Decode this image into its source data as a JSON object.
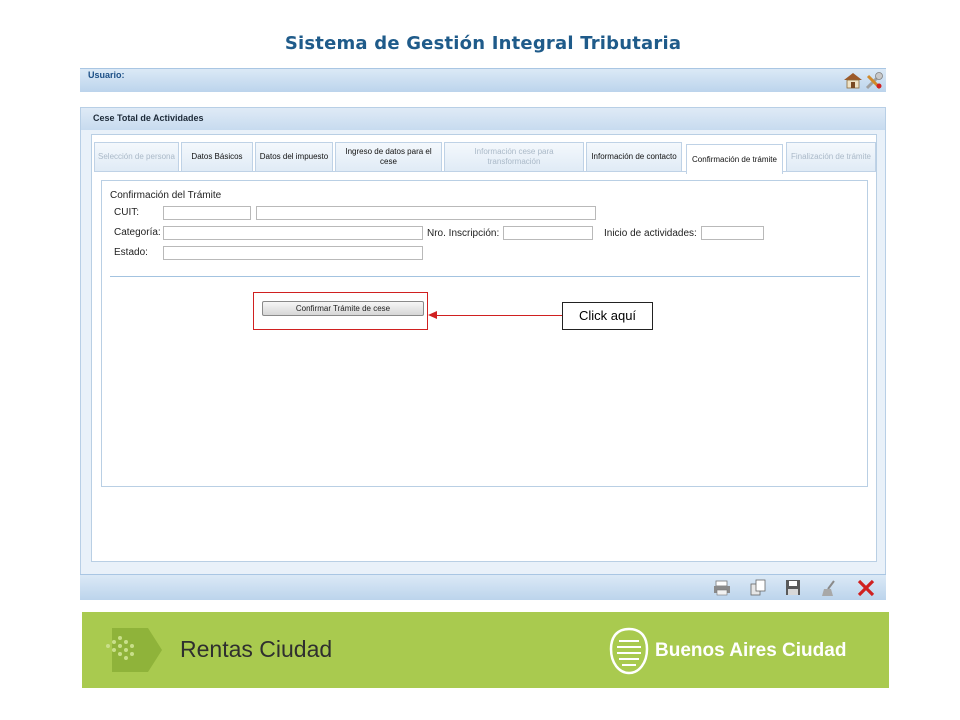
{
  "app_title": "Sistema de Gestión Integral Tributaria",
  "user_bar": {
    "label": "Usuario:"
  },
  "panel": {
    "title": "Cese Total de Actividades"
  },
  "tabs": [
    {
      "label": "Selección de persona",
      "state": "disabled"
    },
    {
      "label": "Datos Básicos",
      "state": "enabled"
    },
    {
      "label": "Datos del impuesto",
      "state": "enabled"
    },
    {
      "label": "Ingreso de datos para el cese",
      "state": "enabled"
    },
    {
      "label": "Información cese para transformación",
      "state": "disabled"
    },
    {
      "label": "Información de contacto",
      "state": "enabled"
    },
    {
      "label": "Confirmación de trámite",
      "state": "active"
    },
    {
      "label": "Finalización de trámite",
      "state": "disabled"
    }
  ],
  "form": {
    "title": "Confirmación del Trámite",
    "cuit_label": "CUIT:",
    "categoria_label": "Categoría:",
    "nro_inscripcion_label": "Nro. Inscripción:",
    "inicio_actividades_label": "Inicio de actividades:",
    "estado_label": "Estado:",
    "confirm_button": "Confirmar Trámite de cese"
  },
  "annotation": {
    "callout": "Click aquí",
    "color": "#d02020"
  },
  "toolbar": {
    "icons": [
      "print-icon",
      "copy-icon",
      "save-icon",
      "clean-icon",
      "close-icon"
    ]
  },
  "footer": {
    "left_brand": "Rentas Ciudad",
    "right_brand": "Buenos Aires Ciudad",
    "background": "#a9ca4f"
  },
  "colors": {
    "title": "#1f5b8a",
    "accent_bar": "#c7dbef",
    "panel_bg": "#e9f1f9"
  }
}
